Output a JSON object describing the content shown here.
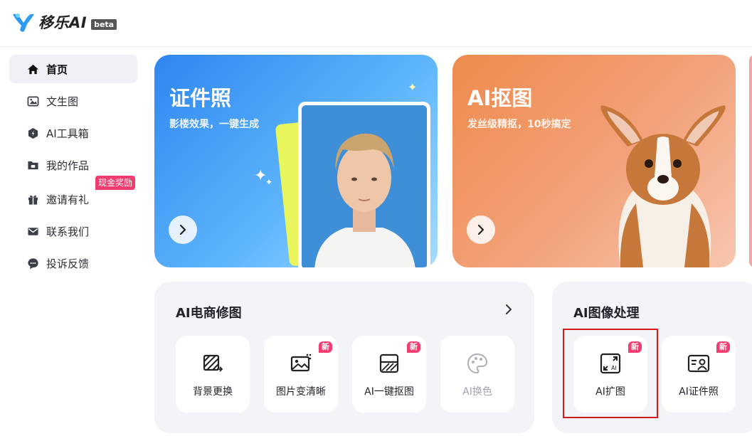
{
  "app": {
    "logo_text": "移乐AI",
    "beta_label": "beta"
  },
  "sidebar": {
    "items": [
      {
        "label": "首页",
        "icon": "home-icon"
      },
      {
        "label": "文生图",
        "icon": "image-icon"
      },
      {
        "label": "AI工具箱",
        "icon": "toolbox-icon"
      },
      {
        "label": "我的作品",
        "icon": "folder-icon"
      },
      {
        "label": "邀请有礼",
        "icon": "gift-icon",
        "promo": "现金奖励"
      },
      {
        "label": "联系我们",
        "icon": "mail-icon"
      },
      {
        "label": "投诉反馈",
        "icon": "chat-icon"
      }
    ]
  },
  "banners": [
    {
      "title": "证件照",
      "subtitle": "影楼效果，一键生成"
    },
    {
      "title": "AI抠图",
      "subtitle": "发丝级精抠，10秒搞定"
    }
  ],
  "panels": [
    {
      "title": "AI电商修图",
      "tools": [
        {
          "label": "背景更换",
          "icon": "background-swap-icon",
          "badge": ""
        },
        {
          "label": "图片变清晰",
          "icon": "image-enhance-icon",
          "badge": "新"
        },
        {
          "label": "AI一键抠图",
          "icon": "cutout-icon",
          "badge": "新"
        },
        {
          "label": "AI换色",
          "icon": "palette-icon",
          "badge": ""
        }
      ]
    },
    {
      "title": "AI图像处理",
      "tools": [
        {
          "label": "AI扩图",
          "icon": "expand-image-icon",
          "badge": "新"
        },
        {
          "label": "AI证件照",
          "icon": "id-photo-icon",
          "badge": "新"
        }
      ]
    }
  ],
  "colors": {
    "accent_pink": "#f03c6e",
    "highlight_red": "#d7191c",
    "banner_blue": "#2f86f0",
    "banner_orange": "#ef8a4d"
  }
}
